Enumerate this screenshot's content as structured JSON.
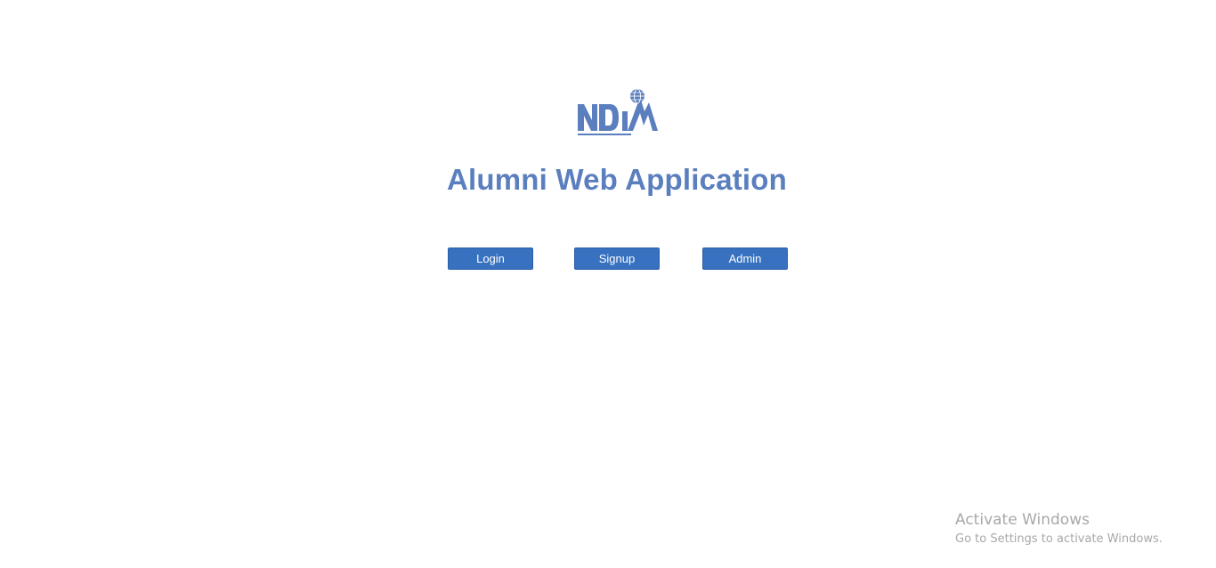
{
  "header": {
    "logo_text": "NDIM",
    "title": "Alumni Web Application"
  },
  "actions": {
    "login_label": "Login",
    "signup_label": "Signup",
    "admin_label": "Admin"
  },
  "watermark": {
    "title": "Activate Windows",
    "subtitle": "Go to Settings to activate Windows."
  },
  "colors": {
    "brand": "#5b7fbe",
    "button": "#3771bf",
    "watermark": "#a8a8a8"
  }
}
